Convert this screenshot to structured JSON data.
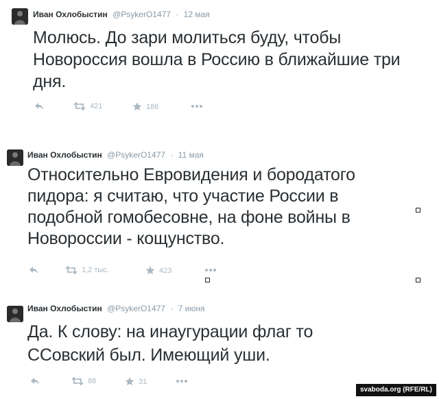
{
  "tweets": [
    {
      "author_name": "Иван Охлобыстин",
      "handle": "@PsykerO1477",
      "date": "12 мая",
      "text": "Молюсь. До зари молиться буду, чтобы Новороссия вошла в Россию в ближайшие три дня.",
      "retweets": "421",
      "favorites": "186"
    },
    {
      "author_name": "Иван Охлобыстин",
      "handle": "@PsykerO1477",
      "date": "11 мая",
      "text": "Относительно Евровидения и бородатого пидора: я считаю, что участие России в подобной гомобесовне, на фоне войны в Новороссии - кощунство.",
      "retweets": "1,2 тыс.",
      "favorites": "423"
    },
    {
      "author_name": "Иван Охлобыстин",
      "handle": "@PsykerO1477",
      "date": "7 июня",
      "text": "Да. К слову: на инаугурации флаг то ССовский был. Имеющий уши.",
      "retweets": "88",
      "favorites": "31"
    }
  ],
  "separator": "·",
  "icons": [
    "reply-icon",
    "retweet-icon",
    "favorite-icon",
    "more-icon"
  ],
  "colors": {
    "text": "#292f33",
    "meta": "#8899a6",
    "action": "#aab8c2",
    "credit_bg": "#111111"
  },
  "credit": "svaboda.org (RFE/RL)"
}
